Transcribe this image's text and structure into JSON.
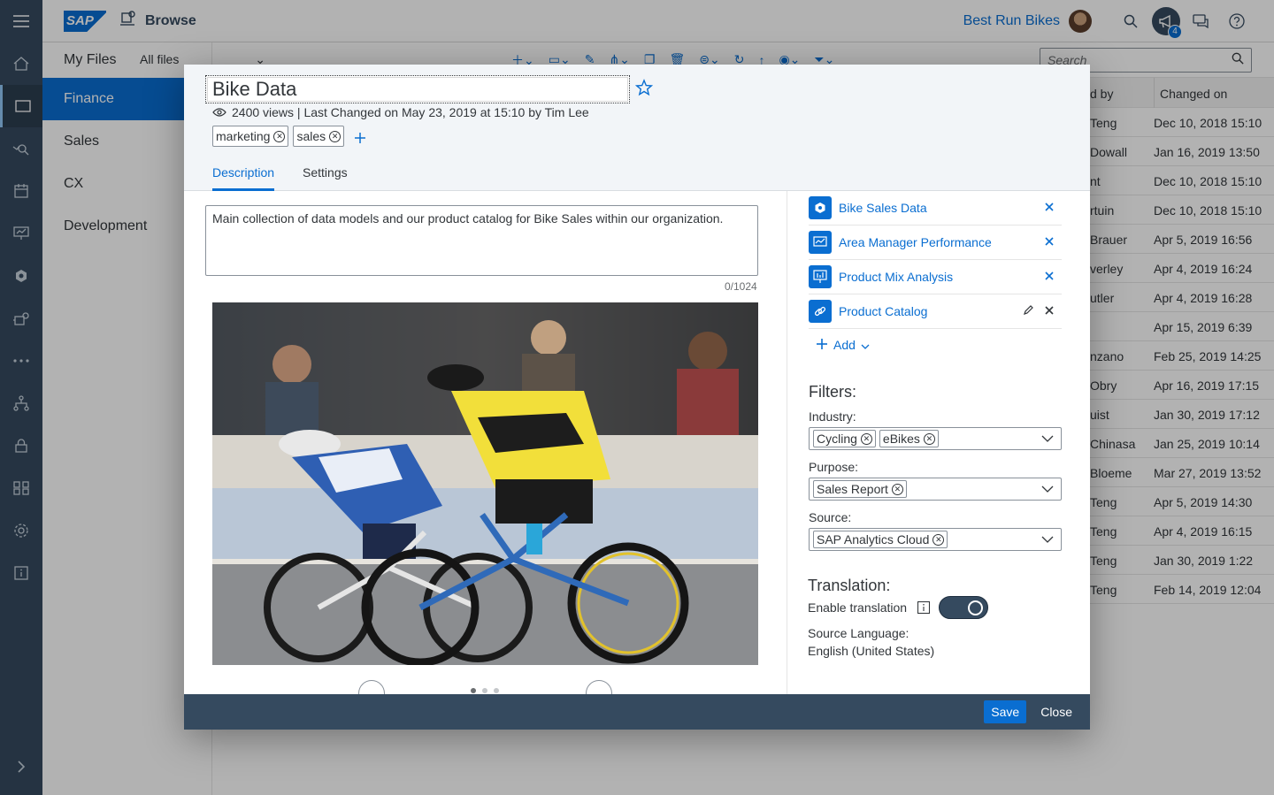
{
  "shell": {
    "app_title": "Browse",
    "tenant": "Best Run Bikes",
    "notification_count": "4",
    "logo_text": "SAP"
  },
  "folders": {
    "header": "My Files",
    "items": [
      "Finance",
      "Sales",
      "CX",
      "Development"
    ]
  },
  "toolbar": {
    "scope": "All files",
    "search_placeholder": "Search"
  },
  "table": {
    "headers": [
      "d by",
      "Changed on"
    ],
    "rows": [
      [
        "Teng",
        "Dec 10, 2018 15:10"
      ],
      [
        "Dowall",
        "Jan 16, 2019 13:50"
      ],
      [
        "nt",
        "Dec 10, 2018 15:10"
      ],
      [
        "rtuin",
        "Dec 10, 2018 15:10"
      ],
      [
        "Brauer",
        "Apr 5, 2019 16:56"
      ],
      [
        "verley",
        "Apr 4, 2019 16:24"
      ],
      [
        "utler",
        "Apr 4, 2019 16:28"
      ],
      [
        "",
        "Apr 15, 2019 6:39"
      ],
      [
        "nzano",
        "Feb 25, 2019 14:25"
      ],
      [
        " Obry",
        "Apr 16, 2019 17:15"
      ],
      [
        "uist",
        "Jan 30, 2019 17:12"
      ],
      [
        "Chinasa",
        "Jan 25, 2019 10:14"
      ],
      [
        " Bloeme",
        "Mar 27, 2019 13:52"
      ],
      [
        "Teng",
        "Apr 5, 2019 14:30"
      ],
      [
        "Teng",
        "Apr 4, 2019 16:15"
      ],
      [
        "Teng",
        "Jan 30, 2019 1:22"
      ],
      [
        "Teng",
        "Feb 14, 2019 12:04"
      ]
    ]
  },
  "dialog": {
    "title": "Bike Data",
    "meta": "2400 views | Last Changed on May 23, 2019 at 15:10 by Tim Lee",
    "tags": [
      "marketing",
      "sales"
    ],
    "tabs": [
      "Description",
      "Settings"
    ],
    "description": "Main collection of data models and our product catalog for Bike Sales within our organization.",
    "counter": "0/1024",
    "carousel": {
      "pages": 3,
      "current": 1
    },
    "models": [
      {
        "label": "Bike Sales Data",
        "icon": "dataset-icon"
      },
      {
        "label": "Area Manager Performance",
        "icon": "story-icon"
      },
      {
        "label": "Product Mix Analysis",
        "icon": "presentation-icon"
      },
      {
        "label": "Product Catalog",
        "icon": "link-icon"
      }
    ],
    "add_label": "Add",
    "filters": {
      "title": "Filters:",
      "industry_label": "Industry:",
      "industry": [
        "Cycling",
        "eBikes"
      ],
      "purpose_label": "Purpose:",
      "purpose": [
        "Sales Report"
      ],
      "source_label": "Source:",
      "source": [
        "SAP Analytics Cloud"
      ]
    },
    "translation": {
      "title": "Translation:",
      "enable_label": "Enable translation",
      "enabled": true,
      "source_language_label": "Source Language:",
      "source_language": "English (United States)"
    },
    "footer": {
      "save": "Save",
      "close": "Close"
    }
  },
  "colors": {
    "accent": "#0a6ed1",
    "shell": "#354a5f",
    "header_bg": "#f2f5f8"
  }
}
